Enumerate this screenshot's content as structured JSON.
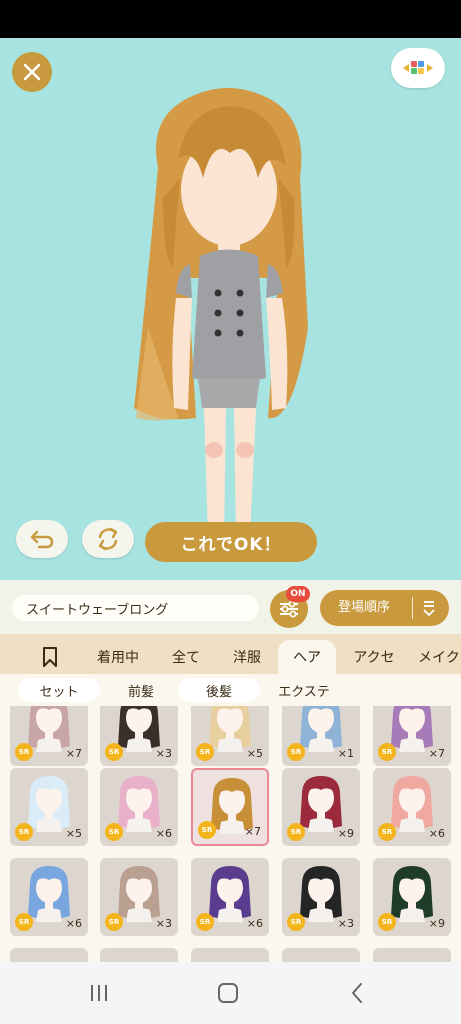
{
  "top_controls": {
    "close_icon": "close-icon",
    "palette_icon": "palette-icon"
  },
  "actions": {
    "ok_label": "これでOK！",
    "undo_icon": "undo-icon",
    "rotate_icon": "rotate-icon"
  },
  "toolbar": {
    "item_name": "スイートウェーブロング",
    "filter_badge": "ON",
    "sort_label": "登場順序"
  },
  "tabs": [
    {
      "label": "",
      "icon": "bookmark-icon"
    },
    {
      "label": "着用中"
    },
    {
      "label": "全て"
    },
    {
      "label": "洋服"
    },
    {
      "label": "ヘア",
      "active": true
    },
    {
      "label": "アクセ"
    },
    {
      "label": "メイク"
    }
  ],
  "subtabs": [
    {
      "label": "セット"
    },
    {
      "label": "前髪"
    },
    {
      "label": "後髪"
    },
    {
      "label": "エクステ"
    }
  ],
  "items": [
    {
      "rarity": "SR",
      "count": "×7",
      "hair": "#c9a6a6"
    },
    {
      "rarity": "SR",
      "count": "×3",
      "hair": "#3a2f2a"
    },
    {
      "rarity": "SR",
      "count": "×5",
      "hair": "#e7cfa0"
    },
    {
      "rarity": "SR",
      "count": "×1",
      "hair": "#8fb3d6"
    },
    {
      "rarity": "SR",
      "count": "×7",
      "hair": "#a77ab8"
    },
    {
      "rarity": "SR",
      "count": "×5",
      "hair": "#d9ecf7"
    },
    {
      "rarity": "SR",
      "count": "×6",
      "hair": "#e9b1c9"
    },
    {
      "rarity": "SR",
      "count": "×7",
      "hair": "#c79038",
      "selected": true
    },
    {
      "rarity": "SR",
      "count": "×9",
      "hair": "#9a2a3c"
    },
    {
      "rarity": "SR",
      "count": "×6",
      "hair": "#f0a9a0"
    },
    {
      "rarity": "SR",
      "count": "×6",
      "hair": "#7aa6e0"
    },
    {
      "rarity": "SR",
      "count": "×3",
      "hair": "#b9a091"
    },
    {
      "rarity": "SR",
      "count": "×6",
      "hair": "#5b3d8f"
    },
    {
      "rarity": "SR",
      "count": "×3",
      "hair": "#252525"
    },
    {
      "rarity": "SR",
      "count": "×9",
      "hair": "#1f3b2a"
    }
  ],
  "navbar": {
    "recent_icon": "recent-apps-icon",
    "home_icon": "home-icon",
    "back_icon": "back-icon"
  },
  "colors": {
    "accent": "#c99a3d",
    "stage_bg": "#a7e4e1",
    "badge": "#e74c3c",
    "sr_badge": "#f3b41c"
  }
}
